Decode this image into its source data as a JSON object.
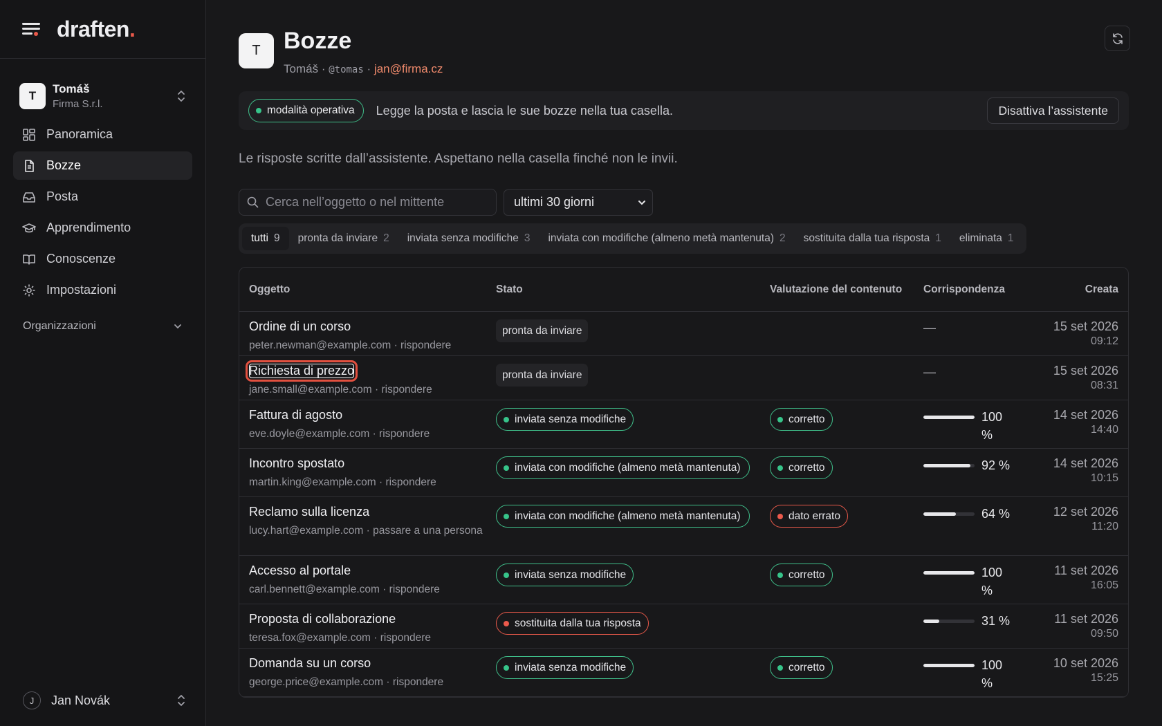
{
  "brand": {
    "logo_text": "draften",
    "logo_dot": "."
  },
  "account": {
    "initial": "T",
    "name": "Tomáš",
    "org": "Firma S.r.l."
  },
  "nav": [
    {
      "label": "Panoramica",
      "icon": "dashboard-icon"
    },
    {
      "label": "Bozze",
      "icon": "document-icon",
      "active": true
    },
    {
      "label": "Posta",
      "icon": "inbox-icon"
    },
    {
      "label": "Apprendimento",
      "icon": "graduation-cap-icon"
    },
    {
      "label": "Conoscenze",
      "icon": "book-icon"
    },
    {
      "label": "Impostazioni",
      "icon": "gear-icon"
    }
  ],
  "organizations_label": "Organizzazioni",
  "user": {
    "initial": "J",
    "name": "Jan Novák"
  },
  "header": {
    "initial": "T",
    "title": "Bozze",
    "name": "Tomáš",
    "sep": "·",
    "handle": "@tomas",
    "email": "jan@firma.cz"
  },
  "banner": {
    "badge": "modalità operativa",
    "text": "Legge la posta e lascia le sue bozze nella tua casella.",
    "button": "Disattiva l’assistente"
  },
  "description": "Le risposte scritte dall’assistente. Aspettano nella casella finché non le invii.",
  "search": {
    "placeholder": "Cerca nell’oggetto o nel mittente",
    "value": ""
  },
  "period_select": {
    "value": "ultimi 30 giorni"
  },
  "tabs": [
    {
      "label": "tutti",
      "count": "9",
      "active": true
    },
    {
      "label": "pronta da inviare",
      "count": "2"
    },
    {
      "label": "inviata senza modifiche",
      "count": "3"
    },
    {
      "label": "inviata con modifiche (almeno metà mantenuta)",
      "count": "2"
    },
    {
      "label": "sostituita dalla tua risposta",
      "count": "1"
    },
    {
      "label": "eliminata",
      "count": "1"
    }
  ],
  "table": {
    "headers": {
      "subject": "Oggetto",
      "status": "Stato",
      "rating": "Valutazione del contenuto",
      "match": "Corrispondenza",
      "created": "Creata"
    },
    "rows": [
      {
        "subject": "Ordine di un corso",
        "meta": "peter.newman@example.com · rispondere",
        "status": "pronta da inviare",
        "status_style": "plain",
        "rating": "",
        "match": "—",
        "date": "15 set 2026",
        "time": "09:12"
      },
      {
        "subject": "Richiesta di prezzo",
        "meta": "jane.small@example.com · rispondere",
        "status": "pronta da inviare",
        "status_style": "plain",
        "rating": "",
        "match": "—",
        "date": "15 set 2026",
        "time": "08:31",
        "focused": true
      },
      {
        "subject": "Fattura di agosto",
        "meta": "eve.doyle@example.com · rispondere",
        "status": "inviata senza modifiche",
        "status_style": "green",
        "rating": "corretto",
        "rating_style": "green",
        "match_value": 100,
        "match": "100 %",
        "date": "14 set 2026",
        "time": "14:40"
      },
      {
        "subject": "Incontro spostato",
        "meta": "martin.king@example.com · rispondere",
        "status": "inviata con modifiche (almeno metà mantenuta)",
        "status_style": "green",
        "rating": "corretto",
        "rating_style": "green",
        "match_value": 92,
        "match": "92 %",
        "date": "14 set 2026",
        "time": "10:15"
      },
      {
        "subject": "Reclamo sulla licenza",
        "meta": "lucy.hart@example.com · passare a una persona",
        "status": "inviata con modifiche (almeno metà mantenuta)",
        "status_style": "green",
        "rating": "dato errato",
        "rating_style": "red",
        "match_value": 64,
        "match": "64 %",
        "date": "12 set 2026",
        "time": "11:20"
      },
      {
        "subject": "Accesso al portale",
        "meta": "carl.bennett@example.com · rispondere",
        "status": "inviata senza modifiche",
        "status_style": "green",
        "rating": "corretto",
        "rating_style": "green",
        "match_value": 100,
        "match": "100 %",
        "date": "11 set 2026",
        "time": "16:05"
      },
      {
        "subject": "Proposta di collaborazione",
        "meta": "teresa.fox@example.com · rispondere",
        "status": "sostituita dalla tua risposta",
        "status_style": "red",
        "rating": "",
        "match_value": 31,
        "match": "31 %",
        "date": "11 set 2026",
        "time": "09:50"
      },
      {
        "subject": "Domanda su un corso",
        "meta": "george.price@example.com · rispondere",
        "status": "inviata senza modifiche",
        "status_style": "green",
        "rating": "corretto",
        "rating_style": "green",
        "match_value": 100,
        "match": "100 %",
        "date": "10 set 2026",
        "time": "15:25"
      }
    ]
  },
  "colors": {
    "accent": "#e8594a",
    "success": "#37c48a",
    "background": "#18181a",
    "sidebar": "#151517"
  }
}
